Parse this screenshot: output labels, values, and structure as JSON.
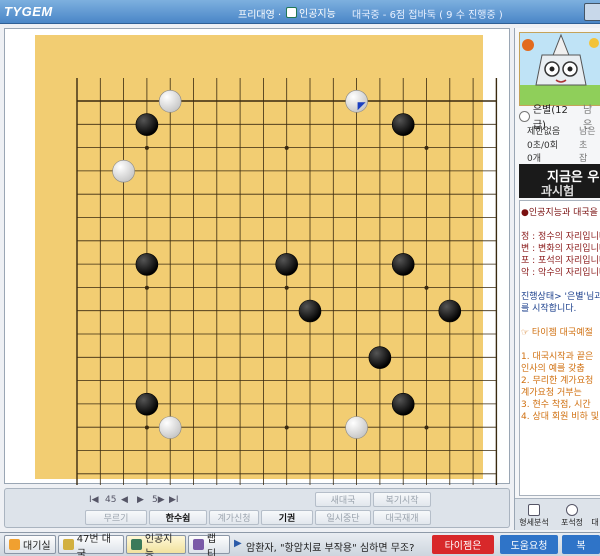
{
  "titlebar": {
    "logo": "TYGEM",
    "title_a": "프리대영 ·",
    "title_b": "인공지능",
    "title_c": "대국중 - 6점 접바둑 ( 9 수 진행중 )"
  },
  "board": {
    "size": 19,
    "bg_color": "#f2cd72",
    "line_color": "#3a2a10",
    "stones": [
      {
        "color": "white",
        "col": 5,
        "row": 2
      },
      {
        "color": "white",
        "col": 13,
        "row": 2,
        "last_move": true
      },
      {
        "color": "black",
        "col": 4,
        "row": 3
      },
      {
        "color": "black",
        "col": 15,
        "row": 3
      },
      {
        "color": "white",
        "col": 3,
        "row": 5
      },
      {
        "color": "black",
        "col": 4,
        "row": 9
      },
      {
        "color": "black",
        "col": 10,
        "row": 9
      },
      {
        "color": "black",
        "col": 15,
        "row": 9
      },
      {
        "color": "black",
        "col": 11,
        "row": 11
      },
      {
        "color": "black",
        "col": 17,
        "row": 11
      },
      {
        "color": "black",
        "col": 14,
        "row": 13
      },
      {
        "color": "black",
        "col": 4,
        "row": 15
      },
      {
        "color": "black",
        "col": 15,
        "row": 15
      },
      {
        "color": "white",
        "col": 5,
        "row": 16
      },
      {
        "color": "white",
        "col": 13,
        "row": 16
      }
    ]
  },
  "controls": {
    "nav": {
      "first": "I◀",
      "prev10": "45",
      "prev": "◀",
      "next": "▶",
      "next10": "5▶",
      "last": "▶I"
    },
    "buttons": {
      "new_game": "새대국",
      "review_start": "복기시작",
      "undo": "무르기",
      "pass": "한수쉼",
      "count_request": "계가신청",
      "resign": "기권",
      "pause": "일시중단",
      "game_end": "대국재개"
    }
  },
  "taskbar": {
    "tabs": [
      "대기실",
      "47번 대국",
      "인공지능",
      "랩티"
    ],
    "ticker": "암환자, \"항암치료 부작용\" 심하면 무조?",
    "btn_tygem": "타이젬은",
    "btn_help": "도움요청",
    "btn_extra": "복"
  },
  "side": {
    "player_name": "은별(12급)",
    "player_right": "남은",
    "rows": [
      {
        "left": "제한없음",
        "right": "남은"
      },
      {
        "left": "0초/0회",
        "right": "초"
      },
      {
        "left": "0개",
        "right": "잡"
      }
    ],
    "banner_a": "지금은 우",
    "banner_b": "과시험",
    "chat": [
      {
        "text": "●인공지능과 대국을",
        "color": "#7a1010"
      },
      {
        "text": "",
        "color": "#000"
      },
      {
        "text": "정 : 정수의 자리입니다",
        "color": "#8a1a1a"
      },
      {
        "text": "변 : 변화의 자리입니다",
        "color": "#8a1a1a"
      },
      {
        "text": "포 : 포석의 자리입니다",
        "color": "#8a1a1a"
      },
      {
        "text": "악 : 악수의 자리입니다",
        "color": "#8a1a1a"
      },
      {
        "text": "",
        "color": "#000"
      },
      {
        "text": "진행상태> '은별'님과",
        "color": "#1b3f8c"
      },
      {
        "text": "를 시작합니다.",
        "color": "#1b3f8c"
      },
      {
        "text": "",
        "color": "#000"
      },
      {
        "text": "☞ 타이젬 대국예절",
        "color": "#d07010"
      },
      {
        "text": "",
        "color": "#000"
      },
      {
        "text": "1. 대국시작과 끝은",
        "color": "#d07010"
      },
      {
        "text": "   인사의 예를 갖춥",
        "color": "#d07010"
      },
      {
        "text": "2. 무리한 계가요청",
        "color": "#d07010"
      },
      {
        "text": "   계가요청 거부는",
        "color": "#d07010"
      },
      {
        "text": "3. 현수 착점, 시간",
        "color": "#d07010"
      },
      {
        "text": "4. 상대 회원 비하 및",
        "color": "#d07010"
      }
    ],
    "bottom": [
      "형세분석",
      "포석정",
      "대"
    ]
  }
}
